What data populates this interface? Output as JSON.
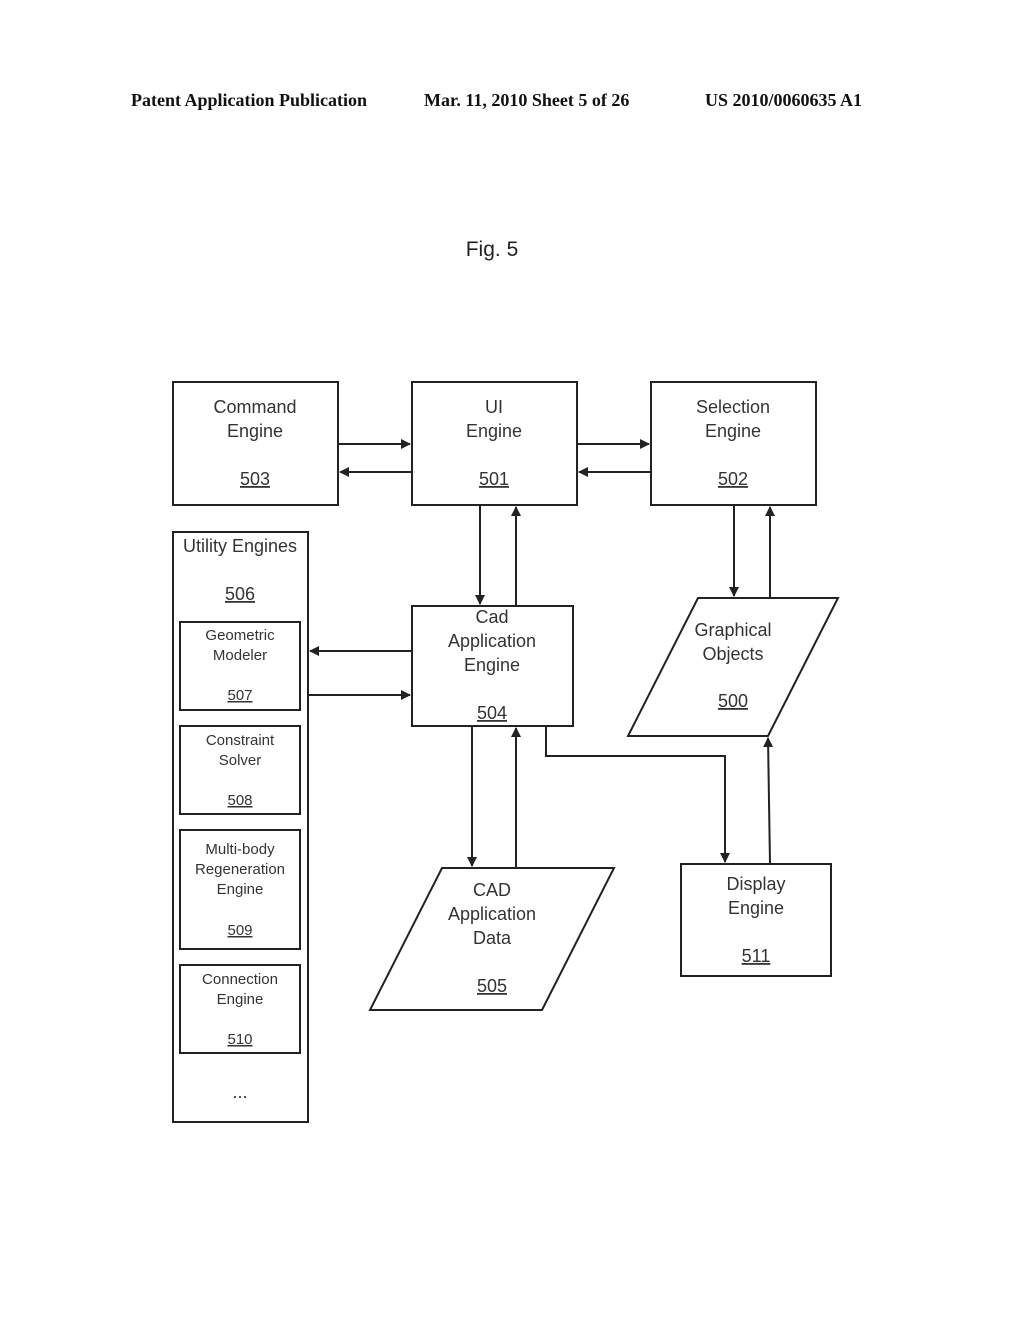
{
  "header": {
    "publication": "Patent Application Publication",
    "date_sheet": "Mar. 11, 2010  Sheet 5 of 26",
    "patent_number": "US 2010/0060635 A1"
  },
  "figure": {
    "title": "Fig. 5"
  },
  "nodes": {
    "command_engine": {
      "lines": [
        "Command",
        "Engine"
      ],
      "ref": "503"
    },
    "ui_engine": {
      "lines": [
        "UI",
        "Engine"
      ],
      "ref": "501"
    },
    "selection_engine": {
      "lines": [
        "Selection",
        "Engine"
      ],
      "ref": "502"
    },
    "utility_engines": {
      "lines": [
        "Utility Engines"
      ],
      "ref": "506",
      "ellipsis": "..."
    },
    "geometric_modeler": {
      "lines": [
        "Geometric",
        "Modeler"
      ],
      "ref": "507"
    },
    "constraint_solver": {
      "lines": [
        "Constraint",
        "Solver"
      ],
      "ref": "508"
    },
    "multibody_regen": {
      "lines": [
        "Multi-body",
        "Regeneration",
        "Engine"
      ],
      "ref": "509"
    },
    "connection_engine": {
      "lines": [
        "Connection",
        "Engine"
      ],
      "ref": "510"
    },
    "cad_app_engine": {
      "lines": [
        "Cad",
        "Application",
        "Engine"
      ],
      "ref": "504"
    },
    "graphical_objects": {
      "lines": [
        "Graphical",
        "Objects"
      ],
      "ref": "500"
    },
    "cad_app_data": {
      "lines": [
        "CAD",
        "Application",
        "Data"
      ],
      "ref": "505"
    },
    "display_engine": {
      "lines": [
        "Display",
        "Engine"
      ],
      "ref": "511"
    }
  },
  "edges": [
    {
      "from": "command_engine",
      "to": "ui_engine"
    },
    {
      "from": "ui_engine",
      "to": "command_engine"
    },
    {
      "from": "ui_engine",
      "to": "selection_engine"
    },
    {
      "from": "selection_engine",
      "to": "ui_engine"
    },
    {
      "from": "ui_engine",
      "to": "cad_app_engine"
    },
    {
      "from": "cad_app_engine",
      "to": "ui_engine"
    },
    {
      "from": "selection_engine",
      "to": "graphical_objects"
    },
    {
      "from": "graphical_objects",
      "to": "selection_engine"
    },
    {
      "from": "cad_app_engine",
      "to": "utility_engines"
    },
    {
      "from": "utility_engines",
      "to": "cad_app_engine"
    },
    {
      "from": "cad_app_engine",
      "to": "cad_app_data"
    },
    {
      "from": "cad_app_data",
      "to": "cad_app_engine"
    },
    {
      "from": "cad_app_engine",
      "to": "display_engine"
    },
    {
      "from": "display_engine",
      "to": "graphical_objects"
    }
  ]
}
